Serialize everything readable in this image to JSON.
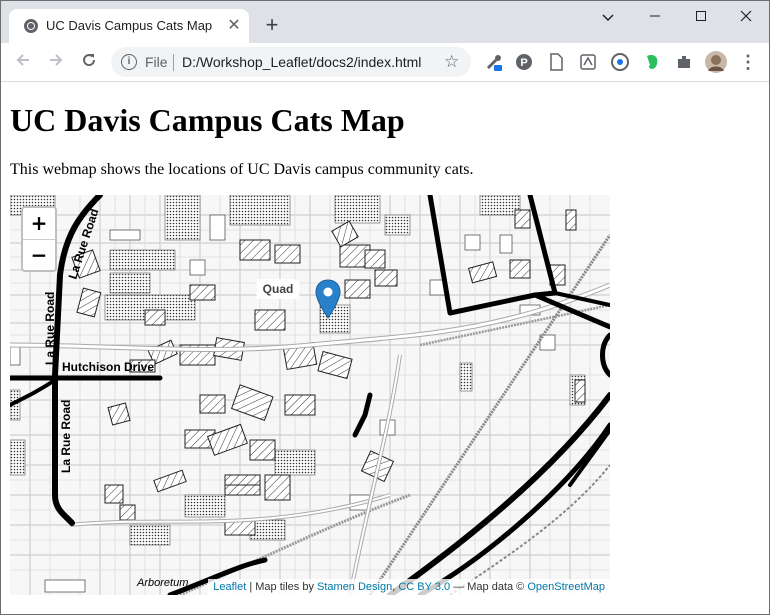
{
  "browser": {
    "tab_title": "UC Davis Campus Cats Map",
    "tab_close": "✕",
    "new_tab": "+",
    "window_controls": {
      "minimize": "—",
      "maximize": "☐",
      "close": "✕",
      "menu": "⌄"
    },
    "nav": {
      "back": "←",
      "forward": "→",
      "reload": "↻"
    },
    "address": {
      "scheme_label": "File",
      "url": "D:/Workshop_Leaflet/docs2/index.html",
      "info_glyph": "i"
    },
    "toolbar_icons": [
      "eyedropper-icon",
      "pinterest-icon",
      "document-icon",
      "pdf-icon",
      "grammarly-icon",
      "evernote-icon",
      "extensions-icon",
      "profile-avatar",
      "menu-icon"
    ],
    "menu_glyph": "⋮",
    "star_glyph": "☆"
  },
  "page": {
    "title": "UC Davis Campus Cats Map",
    "description": "This webmap shows the locations of UC Davis campus community cats."
  },
  "map": {
    "zoom_in": "+",
    "zoom_out": "−",
    "labels": {
      "quad": "Quad",
      "la_rue_road": "La Rue Road",
      "hutchison_drive": "Hutchison Drive",
      "arboretum": "Arboretum"
    },
    "marker_color": "#2a81cb",
    "attribution": {
      "leaflet": "Leaflet",
      "sep1": " | Map tiles by ",
      "stamen": "Stamen Design",
      "sep2": ", ",
      "license": "CC BY 3.0",
      "sep3": " — Map data © ",
      "osm": "OpenStreetMap"
    }
  }
}
